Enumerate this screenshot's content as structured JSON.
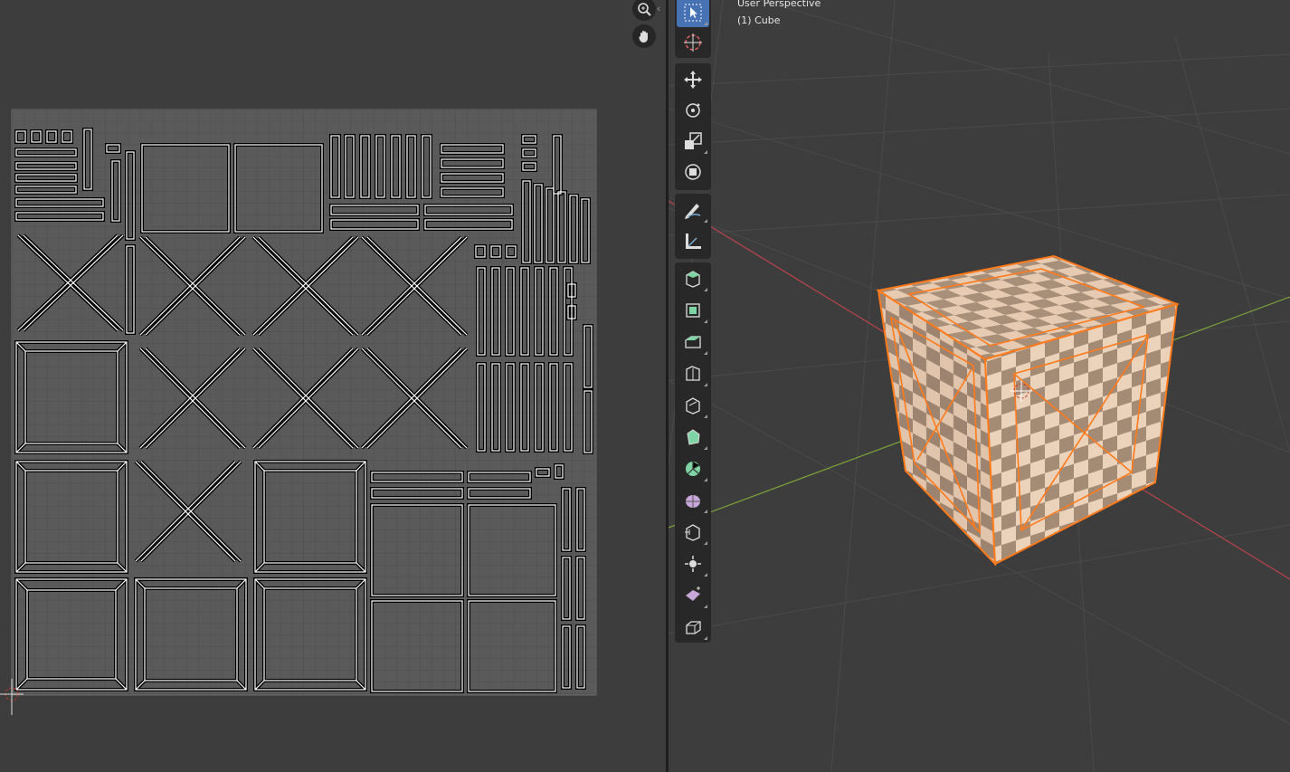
{
  "uv_editor": {
    "nav": {
      "zoom_icon": "zoom-in-icon",
      "pan_icon": "hand-pan-icon"
    },
    "colors": {
      "background": "#3d3d3d",
      "grid": "#575757",
      "texture": "#5a5a5a",
      "edges": "#000000",
      "edge_highlight": "#ffffff"
    }
  },
  "viewport": {
    "perspective_label": "User Perspective",
    "object_label": "(1) Cube",
    "colors": {
      "x_axis": "#c24a52",
      "y_axis": "#7ca23a",
      "selection": "#ff7a1a",
      "checker_light": "#e8cdb5",
      "checker_dark": "#a88e78"
    },
    "tools": [
      {
        "name": "select-box-icon",
        "active": true
      },
      {
        "name": "cursor-icon",
        "active": false
      },
      {
        "name": "move-icon",
        "active": false
      },
      {
        "name": "rotate-icon",
        "active": false
      },
      {
        "name": "scale-icon",
        "active": false
      },
      {
        "name": "transform-icon",
        "active": false
      },
      {
        "name": "annotate-icon",
        "active": false
      },
      {
        "name": "measure-icon",
        "active": false
      },
      {
        "name": "add-cube-icon",
        "active": false
      },
      {
        "name": "extrude-icon",
        "active": false
      },
      {
        "name": "inset-icon",
        "active": false
      },
      {
        "name": "bevel-icon",
        "active": false
      },
      {
        "name": "loop-cut-icon",
        "active": false
      },
      {
        "name": "knife-icon",
        "active": false
      },
      {
        "name": "poly-build-icon",
        "active": false
      },
      {
        "name": "spin-icon",
        "active": false
      },
      {
        "name": "smooth-icon",
        "active": false
      },
      {
        "name": "edge-slide-icon",
        "active": false
      },
      {
        "name": "shrink-fatten-icon",
        "active": false
      },
      {
        "name": "shear-icon",
        "active": false
      },
      {
        "name": "rip-region-icon",
        "active": false
      }
    ]
  }
}
